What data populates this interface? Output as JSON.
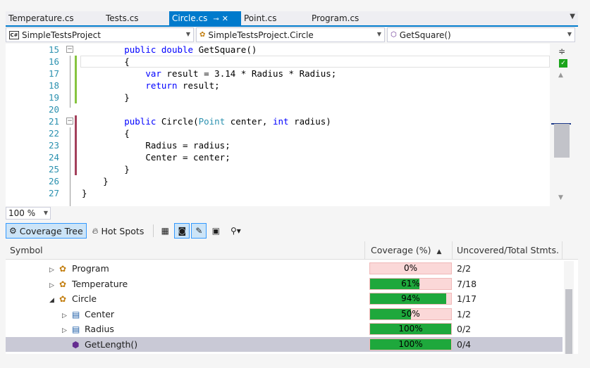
{
  "tabs": [
    {
      "label": "Temperature.cs",
      "active": false
    },
    {
      "label": "Tests.cs",
      "active": false
    },
    {
      "label": "Circle.cs",
      "active": true
    },
    {
      "label": "Point.cs",
      "active": false
    },
    {
      "label": "Program.cs",
      "active": false
    }
  ],
  "navbar": {
    "project": "SimpleTestsProject",
    "type": "SimpleTestsProject.Circle",
    "member": "GetSquare()"
  },
  "editor": {
    "zoom": "100 %",
    "lines": [
      {
        "num": "15",
        "text": "        public double GetSquare()",
        "coverage": "none",
        "fold": "minus"
      },
      {
        "num": "16",
        "text": "        {",
        "coverage": "covered"
      },
      {
        "num": "17",
        "text": "            var result = 3.14 * Radius * Radius;",
        "coverage": "covered"
      },
      {
        "num": "18",
        "text": "            return result;",
        "coverage": "covered"
      },
      {
        "num": "19",
        "text": "        }",
        "coverage": "covered"
      },
      {
        "num": "20",
        "text": "",
        "coverage": "none"
      },
      {
        "num": "21",
        "text": "        public Circle(Point center, int radius)",
        "coverage": "uncovered",
        "fold": "minus"
      },
      {
        "num": "22",
        "text": "        {",
        "coverage": "uncovered"
      },
      {
        "num": "23",
        "text": "            Radius = radius;",
        "coverage": "uncovered"
      },
      {
        "num": "24",
        "text": "            Center = center;",
        "coverage": "uncovered"
      },
      {
        "num": "25",
        "text": "        }",
        "coverage": "uncovered"
      },
      {
        "num": "26",
        "text": "    }",
        "coverage": "none"
      },
      {
        "num": "27",
        "text": "}",
        "coverage": "none"
      }
    ]
  },
  "toolbar": {
    "coverage_tree": "Coverage Tree",
    "hot_spots": "Hot Spots"
  },
  "grid": {
    "headers": {
      "symbol": "Symbol",
      "coverage": "Coverage (%)",
      "uncovered": "Uncovered/Total Stmts."
    },
    "rows": [
      {
        "name": "Program",
        "indent": 1,
        "expander": "collapsed",
        "icon": "class-icon",
        "coverage_pct": 0,
        "coverage_label": "0%",
        "stmts": "2/2",
        "selected": false
      },
      {
        "name": "Temperature",
        "indent": 1,
        "expander": "collapsed",
        "icon": "class-icon",
        "coverage_pct": 61,
        "coverage_label": "61%",
        "stmts": "7/18",
        "selected": false
      },
      {
        "name": "Circle",
        "indent": 1,
        "expander": "expanded",
        "icon": "class-icon",
        "coverage_pct": 94,
        "coverage_label": "94%",
        "stmts": "1/17",
        "selected": false
      },
      {
        "name": "Center",
        "indent": 2,
        "expander": "collapsed",
        "icon": "property-icon",
        "coverage_pct": 50,
        "coverage_label": "50%",
        "stmts": "1/2",
        "selected": false
      },
      {
        "name": "Radius",
        "indent": 2,
        "expander": "collapsed",
        "icon": "property-icon",
        "coverage_pct": 100,
        "coverage_label": "100%",
        "stmts": "0/2",
        "selected": false
      },
      {
        "name": "GetLength()",
        "indent": 2,
        "expander": "none",
        "icon": "method-icon",
        "coverage_pct": 100,
        "coverage_label": "100%",
        "stmts": "0/4",
        "selected": true
      }
    ]
  },
  "colors": {
    "accent": "#007acc",
    "covered": "#86c440",
    "uncovered": "#a3405b",
    "bar_fill": "#1ea83c",
    "bar_empty": "#fbd8d8"
  }
}
